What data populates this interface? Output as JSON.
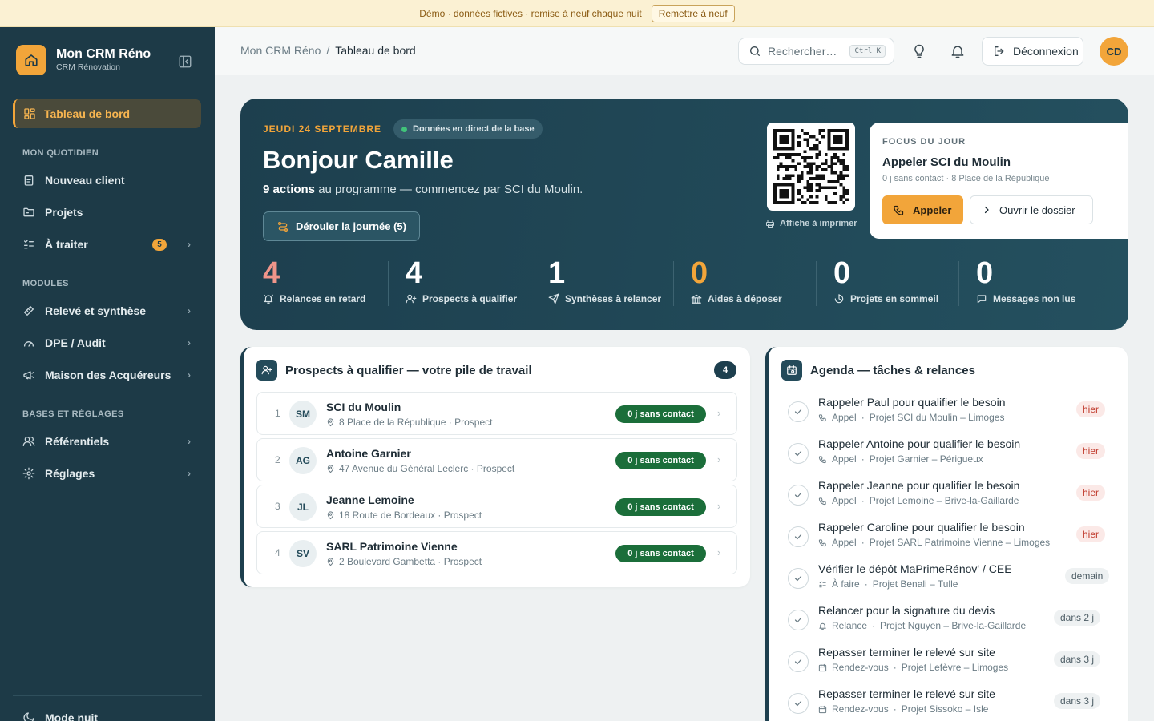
{
  "banner": {
    "text": "Démo · données fictives · remise à neuf chaque nuit",
    "reset_label": "Remettre à neuf"
  },
  "brand": {
    "name": "Mon CRM Réno",
    "subtitle": "CRM Rénovation"
  },
  "nav": {
    "active_label": "Tableau de bord",
    "section_daily": "MON QUOTIDIEN",
    "new_client": "Nouveau client",
    "projects": "Projets",
    "to_process": "À traiter",
    "to_process_badge": "5",
    "section_modules": "MODULES",
    "survey": "Relevé et synthèse",
    "dpe": "DPE / Audit",
    "buyers": "Maison des Acquéreurs",
    "section_settings": "BASES ET RÉGLAGES",
    "references": "Référentiels",
    "settings": "Réglages",
    "night_mode": "Mode nuit"
  },
  "topbar": {
    "crumb_root": "Mon CRM Réno",
    "crumb_sep": "/",
    "crumb_current": "Tableau de bord",
    "search_placeholder": "Rechercher…",
    "search_shortcut": "Ctrl K",
    "logout_label": "Déconnexion",
    "avatar_initials": "CD"
  },
  "hero": {
    "date": "JEUDI 24 SEPTEMBRE",
    "live_label": "Données en direct de la base",
    "greeting": "Bonjour Camille",
    "summary_bold": "9 actions",
    "summary_rest": " au programme — commencez par SCI du Moulin.",
    "run_day_label": "Dérouler la journée (5)",
    "print_label": "Affiche à imprimer",
    "focus": {
      "kicker": "FOCUS DU JOUR",
      "title": "Appeler SCI du Moulin",
      "subtitle": "0 j sans contact · 8 Place de la République",
      "call_label": "Appeler",
      "open_label": "Ouvrir le dossier"
    },
    "kpis": [
      {
        "value": "4",
        "label": "Relances en retard",
        "color": "#f0958a"
      },
      {
        "value": "4",
        "label": "Prospects à qualifier",
        "color": "#ffffff"
      },
      {
        "value": "1",
        "label": "Synthèses à relancer",
        "color": "#ffffff"
      },
      {
        "value": "0",
        "label": "Aides à déposer",
        "color": "#f2a53a"
      },
      {
        "value": "0",
        "label": "Projets en sommeil",
        "color": "#ffffff"
      },
      {
        "value": "0",
        "label": "Messages non lus",
        "color": "#ffffff"
      }
    ]
  },
  "prospects": {
    "title": "Prospects à qualifier — votre pile de travail",
    "count": "4",
    "rows": [
      {
        "num": "1",
        "initials": "SM",
        "name": "SCI du Moulin",
        "address": "8 Place de la République · Prospect",
        "badge": "0 j sans contact"
      },
      {
        "num": "2",
        "initials": "AG",
        "name": "Antoine Garnier",
        "address": "47 Avenue du Général Leclerc · Prospect",
        "badge": "0 j sans contact"
      },
      {
        "num": "3",
        "initials": "JL",
        "name": "Jeanne Lemoine",
        "address": "18 Route de Bordeaux · Prospect",
        "badge": "0 j sans contact"
      },
      {
        "num": "4",
        "initials": "SV",
        "name": "SARL Patrimoine Vienne",
        "address": "2 Boulevard Gambetta · Prospect",
        "badge": "0 j sans contact"
      }
    ]
  },
  "agenda": {
    "title": "Agenda — tâches & relances",
    "tasks": [
      {
        "title": "Rappeler Paul pour qualifier le besoin",
        "type": "Appel",
        "project": "Projet SCI du Moulin – Limoges",
        "due": "hier",
        "late": true
      },
      {
        "title": "Rappeler Antoine pour qualifier le besoin",
        "type": "Appel",
        "project": "Projet Garnier – Périgueux",
        "due": "hier",
        "late": true
      },
      {
        "title": "Rappeler Jeanne pour qualifier le besoin",
        "type": "Appel",
        "project": "Projet Lemoine – Brive-la-Gaillarde",
        "due": "hier",
        "late": true
      },
      {
        "title": "Rappeler Caroline pour qualifier le besoin",
        "type": "Appel",
        "project": "Projet SARL Patrimoine Vienne – Limoges",
        "due": "hier",
        "late": true
      },
      {
        "title": "Vérifier le dépôt MaPrimeRénov' / CEE",
        "type": "À faire",
        "project": "Projet Benali – Tulle",
        "due": "demain",
        "late": false
      },
      {
        "title": "Relancer pour la signature du devis",
        "type": "Relance",
        "project": "Projet Nguyen – Brive-la-Gaillarde",
        "due": "dans 2 j",
        "late": false
      },
      {
        "title": "Repasser terminer le relevé sur site",
        "type": "Rendez-vous",
        "project": "Projet Lefèvre – Limoges",
        "due": "dans 3 j",
        "late": false
      },
      {
        "title": "Repasser terminer le relevé sur site",
        "type": "Rendez-vous",
        "project": "Projet Sissoko – Isle",
        "due": "dans 3 j",
        "late": false
      }
    ]
  }
}
